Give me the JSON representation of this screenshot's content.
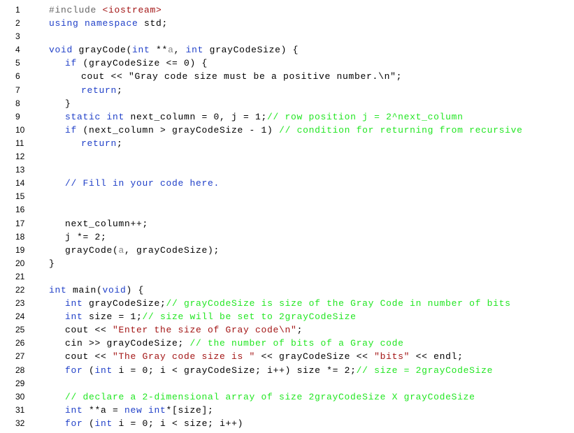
{
  "editor": {
    "language": "C++",
    "colors": {
      "keyword": "#2040c8",
      "comment": "#22e622",
      "string": "#a31515",
      "preprocessor": "#666666",
      "parameter": "#888888",
      "text": "#000000"
    },
    "lines": [
      {
        "n": "1",
        "indent": 0,
        "tokens": [
          {
            "t": "pp",
            "v": "#include "
          },
          {
            "t": "str",
            "v": "<iostream>"
          }
        ]
      },
      {
        "n": "2",
        "indent": 0,
        "tokens": [
          {
            "t": "kw",
            "v": "using namespace "
          },
          {
            "t": "plain",
            "v": "std;"
          }
        ]
      },
      {
        "n": "3",
        "indent": 0,
        "tokens": []
      },
      {
        "n": "4",
        "indent": 0,
        "tokens": [
          {
            "t": "kw",
            "v": "void "
          },
          {
            "t": "plain",
            "v": "grayCode("
          },
          {
            "t": "kw",
            "v": "int "
          },
          {
            "t": "plain",
            "v": "**"
          },
          {
            "t": "param",
            "v": "a"
          },
          {
            "t": "plain",
            "v": ", "
          },
          {
            "t": "kw",
            "v": "int "
          },
          {
            "t": "plain",
            "v": "grayCodeSize) {"
          }
        ]
      },
      {
        "n": "5",
        "indent": 1,
        "tokens": [
          {
            "t": "kw",
            "v": "if "
          },
          {
            "t": "plain",
            "v": "(grayCodeSize <= 0) {"
          }
        ]
      },
      {
        "n": "6",
        "indent": 2,
        "tokens": [
          {
            "t": "plain",
            "v": "cout << \"Gray code size must be a positive number.\\n\";"
          }
        ]
      },
      {
        "n": "7",
        "indent": 2,
        "tokens": [
          {
            "t": "kw",
            "v": "return"
          },
          {
            "t": "plain",
            "v": ";"
          }
        ]
      },
      {
        "n": "8",
        "indent": 1,
        "tokens": [
          {
            "t": "plain",
            "v": "}"
          }
        ]
      },
      {
        "n": "9",
        "indent": 1,
        "tokens": [
          {
            "t": "kw",
            "v": "static int "
          },
          {
            "t": "plain",
            "v": "next_column = 0, j = 1;"
          },
          {
            "t": "com",
            "v": "// row position j = 2^next_column"
          }
        ]
      },
      {
        "n": "10",
        "indent": 1,
        "tokens": [
          {
            "t": "kw",
            "v": "if "
          },
          {
            "t": "plain",
            "v": "(next_column > grayCodeSize - 1) "
          },
          {
            "t": "com",
            "v": "// condition for returning from recursive"
          }
        ]
      },
      {
        "n": "11",
        "indent": 2,
        "tokens": [
          {
            "t": "kw",
            "v": "return"
          },
          {
            "t": "plain",
            "v": ";"
          }
        ]
      },
      {
        "n": "12",
        "indent": 0,
        "tokens": []
      },
      {
        "n": "13",
        "indent": 0,
        "tokens": []
      },
      {
        "n": "14",
        "indent": 1,
        "tokens": [
          {
            "t": "note",
            "v": "// Fill in your code here."
          }
        ]
      },
      {
        "n": "15",
        "indent": 0,
        "tokens": []
      },
      {
        "n": "16",
        "indent": 0,
        "tokens": []
      },
      {
        "n": "17",
        "indent": 1,
        "tokens": [
          {
            "t": "plain",
            "v": "next_column++;"
          }
        ]
      },
      {
        "n": "18",
        "indent": 1,
        "tokens": [
          {
            "t": "plain",
            "v": "j *= 2;"
          }
        ]
      },
      {
        "n": "19",
        "indent": 1,
        "tokens": [
          {
            "t": "plain",
            "v": "grayCode("
          },
          {
            "t": "param",
            "v": "a"
          },
          {
            "t": "plain",
            "v": ", grayCodeSize);"
          }
        ]
      },
      {
        "n": "20",
        "indent": 0,
        "tokens": [
          {
            "t": "plain",
            "v": "}"
          }
        ]
      },
      {
        "n": "21",
        "indent": 0,
        "tokens": []
      },
      {
        "n": "22",
        "indent": 0,
        "tokens": [
          {
            "t": "kw",
            "v": "int "
          },
          {
            "t": "plain",
            "v": "main("
          },
          {
            "t": "kw",
            "v": "void"
          },
          {
            "t": "plain",
            "v": ") {"
          }
        ]
      },
      {
        "n": "23",
        "indent": 1,
        "tokens": [
          {
            "t": "kw",
            "v": "int "
          },
          {
            "t": "plain",
            "v": "grayCodeSize;"
          },
          {
            "t": "com",
            "v": "// grayCodeSize is size of the Gray Code in number of bits"
          }
        ]
      },
      {
        "n": "24",
        "indent": 1,
        "tokens": [
          {
            "t": "kw",
            "v": "int "
          },
          {
            "t": "plain",
            "v": "size = 1;"
          },
          {
            "t": "com",
            "v": "// size will be set to 2grayCodeSize"
          }
        ]
      },
      {
        "n": "25",
        "indent": 1,
        "tokens": [
          {
            "t": "plain",
            "v": "cout << "
          },
          {
            "t": "str",
            "v": "\"Enter the size of Gray code\\n\""
          },
          {
            "t": "plain",
            "v": ";"
          }
        ]
      },
      {
        "n": "26",
        "indent": 1,
        "tokens": [
          {
            "t": "plain",
            "v": "cin >> grayCodeSize; "
          },
          {
            "t": "com",
            "v": "// the number of bits of a Gray code"
          }
        ]
      },
      {
        "n": "27",
        "indent": 1,
        "tokens": [
          {
            "t": "plain",
            "v": "cout << "
          },
          {
            "t": "str",
            "v": "\"The Gray code size is \""
          },
          {
            "t": "plain",
            "v": " << grayCodeSize << "
          },
          {
            "t": "str",
            "v": "\"bits\""
          },
          {
            "t": "plain",
            "v": " << endl;"
          }
        ]
      },
      {
        "n": "28",
        "indent": 1,
        "tokens": [
          {
            "t": "kw",
            "v": "for "
          },
          {
            "t": "plain",
            "v": "("
          },
          {
            "t": "kw",
            "v": "int "
          },
          {
            "t": "plain",
            "v": "i = 0; i < grayCodeSize; i++) size *= 2;"
          },
          {
            "t": "com",
            "v": "// size = 2grayCodeSize"
          }
        ]
      },
      {
        "n": "29",
        "indent": 0,
        "tokens": []
      },
      {
        "n": "30",
        "indent": 1,
        "tokens": [
          {
            "t": "com",
            "v": "// declare a 2-dimensional array of size 2grayCodeSize X grayCodeSize"
          }
        ]
      },
      {
        "n": "31",
        "indent": 1,
        "tokens": [
          {
            "t": "kw",
            "v": "int "
          },
          {
            "t": "plain",
            "v": "**a = "
          },
          {
            "t": "kw",
            "v": "new int"
          },
          {
            "t": "plain",
            "v": "*[size];"
          }
        ]
      },
      {
        "n": "32",
        "indent": 1,
        "tokens": [
          {
            "t": "kw",
            "v": "for "
          },
          {
            "t": "plain",
            "v": "("
          },
          {
            "t": "kw",
            "v": "int "
          },
          {
            "t": "plain",
            "v": "i = 0; i < size; i++)"
          }
        ]
      }
    ]
  }
}
